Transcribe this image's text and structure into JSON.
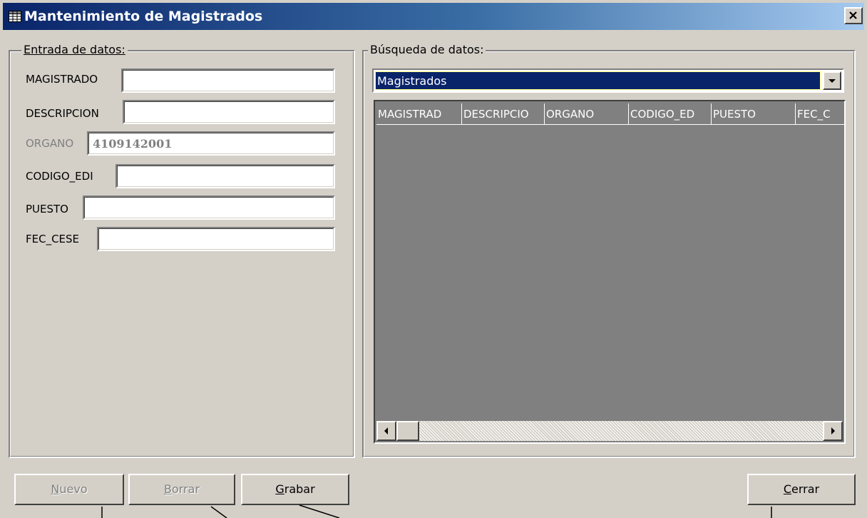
{
  "window": {
    "title": "Mantenimiento de Magistrados",
    "close_label": "×"
  },
  "entry": {
    "legend": "Entrada de datos:",
    "fields": [
      {
        "label": "MAGISTRADO",
        "value": ""
      },
      {
        "label": "DESCRIPCION",
        "value": ""
      },
      {
        "label": "ORGANO",
        "value": "4109142001"
      },
      {
        "label": "CODIGO_EDI",
        "value": ""
      },
      {
        "label": "PUESTO",
        "value": ""
      },
      {
        "label": "FEC_CESE",
        "value": ""
      }
    ]
  },
  "search": {
    "legend": "Búsqueda de datos:",
    "combo_value": "Magistrados",
    "columns": [
      "MAGISTRAD",
      "DESCRIPCIO",
      "ORGANO",
      "CODIGO_ED",
      "PUESTO",
      "FEC_C"
    ]
  },
  "buttons": {
    "nuevo_pre": "",
    "nuevo_acc": "N",
    "nuevo_post": "uevo",
    "borrar_pre": "",
    "borrar_acc": "B",
    "borrar_post": "orrar",
    "grabar_pre": "",
    "grabar_acc": "G",
    "grabar_post": "rabar",
    "cerrar_pre": "",
    "cerrar_acc": "C",
    "cerrar_post": "errar"
  },
  "colors": {
    "titlebar": "#0a246a",
    "window_bg": "#d4d0c8",
    "grid_bg": "#808080",
    "selection": "#0a246a"
  }
}
